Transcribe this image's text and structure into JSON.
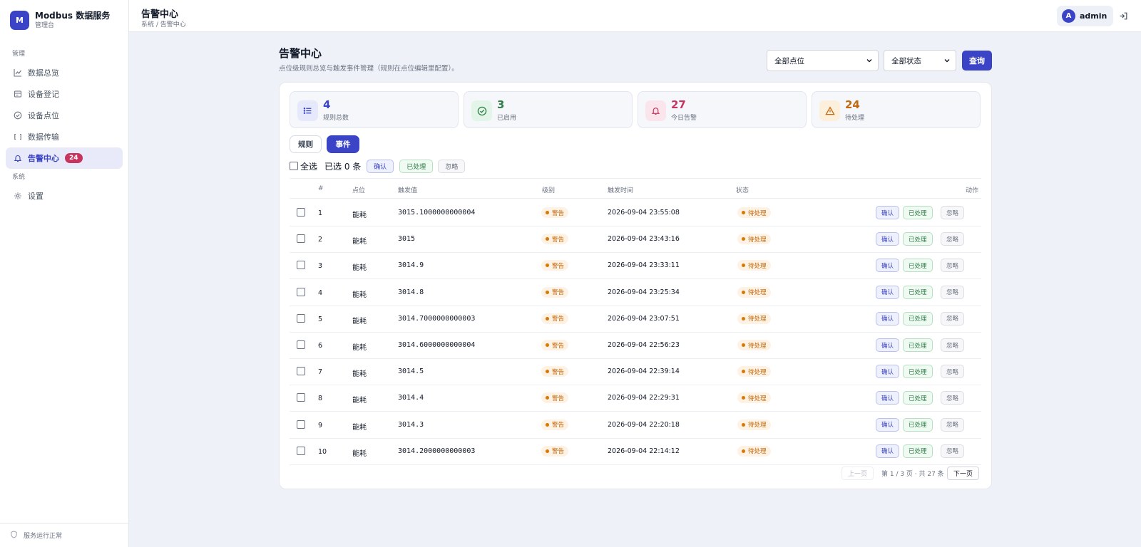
{
  "app": {
    "logo_letter": "M",
    "name": "Modbus 数据服务",
    "subtitle": "管理台"
  },
  "sidebar": {
    "group_manage": "管理",
    "group_system": "系统",
    "items": [
      {
        "label": "数据总览",
        "icon": "chart-line-icon"
      },
      {
        "label": "设备登记",
        "icon": "device-register-icon"
      },
      {
        "label": "设备点位",
        "icon": "check-circle-icon"
      },
      {
        "label": "数据传输",
        "icon": "transfer-icon"
      },
      {
        "label": "告警中心",
        "icon": "bell-icon",
        "badge": "24",
        "active": true
      },
      {
        "label": "设置",
        "icon": "gear-icon"
      }
    ],
    "footer": "服务运行正常"
  },
  "topbar": {
    "title": "告警中心",
    "breadcrumb": "系统 / 告警中心",
    "user_initial": "A",
    "user_name": "admin"
  },
  "page": {
    "title": "告警中心",
    "description": "点位级规则总览与触发事件管理（规则在点位编辑里配置）。",
    "point_filter": "全部点位",
    "status_filter": "全部状态",
    "query_label": "查询"
  },
  "stats": [
    {
      "value": "4",
      "label": "规则总数",
      "color": "#3b44c6"
    },
    {
      "value": "3",
      "label": "已启用",
      "color": "#2f7d47"
    },
    {
      "value": "27",
      "label": "今日告警",
      "color": "#c7355f"
    },
    {
      "value": "24",
      "label": "待处理",
      "color": "#c2690e"
    }
  ],
  "tabs": {
    "rules": "规则",
    "events": "事件"
  },
  "bulk": {
    "select_all": "全选",
    "selected_count": "已选 0 条",
    "confirm": "确认",
    "done": "已处理",
    "ignore": "忽略"
  },
  "table": {
    "headers": {
      "idx": "#",
      "point": "点位",
      "value": "触发值",
      "level": "级别",
      "time": "触发时间",
      "status": "状态",
      "action": "动作"
    },
    "rows": [
      {
        "idx": "1",
        "point": "能耗",
        "value": "3015.1000000000004",
        "level": "警告",
        "time": "2026-09-04 23:55:08",
        "status": "待处理"
      },
      {
        "idx": "2",
        "point": "能耗",
        "value": "3015",
        "level": "警告",
        "time": "2026-09-04 23:43:16",
        "status": "待处理"
      },
      {
        "idx": "3",
        "point": "能耗",
        "value": "3014.9",
        "level": "警告",
        "time": "2026-09-04 23:33:11",
        "status": "待处理"
      },
      {
        "idx": "4",
        "point": "能耗",
        "value": "3014.8",
        "level": "警告",
        "time": "2026-09-04 23:25:34",
        "status": "待处理"
      },
      {
        "idx": "5",
        "point": "能耗",
        "value": "3014.7000000000003",
        "level": "警告",
        "time": "2026-09-04 23:07:51",
        "status": "待处理"
      },
      {
        "idx": "6",
        "point": "能耗",
        "value": "3014.6000000000004",
        "level": "警告",
        "time": "2026-09-04 22:56:23",
        "status": "待处理"
      },
      {
        "idx": "7",
        "point": "能耗",
        "value": "3014.5",
        "level": "警告",
        "time": "2026-09-04 22:39:14",
        "status": "待处理"
      },
      {
        "idx": "8",
        "point": "能耗",
        "value": "3014.4",
        "level": "警告",
        "time": "2026-09-04 22:29:31",
        "status": "待处理"
      },
      {
        "idx": "9",
        "point": "能耗",
        "value": "3014.3",
        "level": "警告",
        "time": "2026-09-04 22:20:18",
        "status": "待处理"
      },
      {
        "idx": "10",
        "point": "能耗",
        "value": "3014.2000000000003",
        "level": "警告",
        "time": "2026-09-04 22:14:12",
        "status": "待处理"
      }
    ],
    "actions": {
      "confirm": "确认",
      "done": "已处理",
      "ignore": "忽略"
    }
  },
  "pager": {
    "prev": "上一页",
    "info": "第 1 / 3 页 · 共 27 条",
    "next": "下一页"
  }
}
